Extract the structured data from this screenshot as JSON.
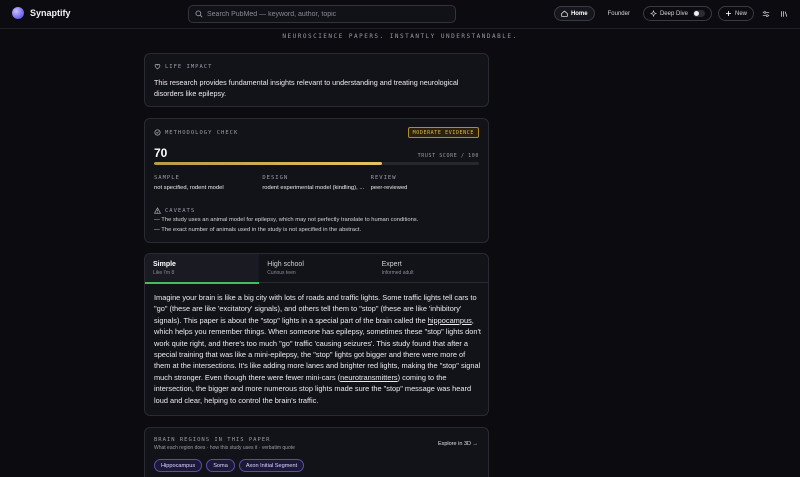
{
  "app": {
    "name": "Synaptify"
  },
  "search": {
    "placeholder": "Search PubMed — keyword, author, topic"
  },
  "nav": {
    "home": "Home",
    "founder": "Founder",
    "deep_dive": "Deep Dive",
    "new": "New"
  },
  "tagline": "NEUROSCIENCE PAPERS. INSTANTLY UNDERSTANDABLE.",
  "life_impact": {
    "label": "LIFE IMPACT",
    "text": "This research provides fundamental insights relevant to understanding and treating neurological disorders like epilepsy."
  },
  "methodology": {
    "label": "METHODOLOGY CHECK",
    "badge": "MODERATE EVIDENCE",
    "score": "70",
    "score_max": "TRUST SCORE / 100",
    "score_fraction": 0.7,
    "stats": [
      {
        "label": "SAMPLE",
        "value": "not specified, rodent model"
      },
      {
        "label": "DESIGN",
        "value": "rodent experimental model (kindling), ..."
      },
      {
        "label": "REVIEW",
        "value": "peer-reviewed"
      }
    ],
    "caveats_label": "CAVEATS",
    "caveats": [
      "— The study uses an animal model for epilepsy, which may not perfectly translate to human conditions.",
      "— The exact number of animals used in the study is not specified in the abstract."
    ]
  },
  "explain": {
    "tabs": [
      {
        "title": "Simple",
        "sub": "Like I'm 8"
      },
      {
        "title": "High school",
        "sub": "Curious teen"
      },
      {
        "title": "Expert",
        "sub": "Informed adult"
      }
    ],
    "p1": "Imagine your brain is like a big city with lots of roads and traffic lights. Some traffic lights tell cars to \"go\" (these are like 'excitatory' signals), and others tell them to \"stop\" (these are like 'inhibitory' signals). This paper is about the \"stop\" lights in a special part of the brain called the ",
    "term1": "hippocampus",
    "p2": ", which helps you remember things. When someone has epilepsy, sometimes these \"stop\" lights don't work quite right, and there's too much \"go\" traffic 'causing seizures'. This study found that after a special training that was like a mini-epilepsy, the \"stop\" lights got bigger and there were more of them at the intersections. It's like adding more lanes and brighter red lights, making the \"stop\" signal much stronger. Even though there were fewer mini-cars (",
    "term2": "neurotransmitters",
    "p3": ") coming to the intersection, the bigger and more numerous stop lights made sure the \"stop\" message was heard loud and clear, helping to control the brain's traffic."
  },
  "regions": {
    "label": "BRAIN REGIONS IN THIS PAPER",
    "sub": "What each region does · how this study uses it · verbatim quote",
    "explore": "Explore in 3D →",
    "items": [
      "Hippocampus",
      "Soma",
      "Axon Initial Segment"
    ]
  }
}
